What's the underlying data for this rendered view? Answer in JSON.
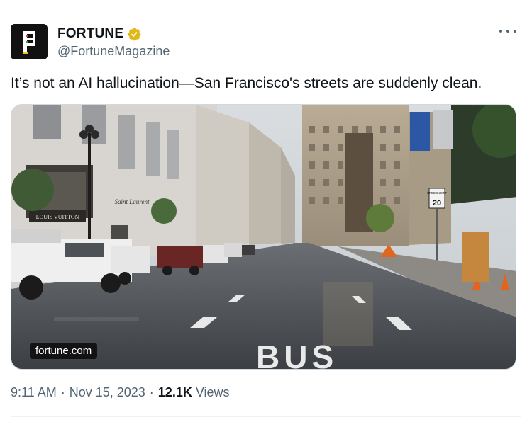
{
  "author": {
    "name": "FORTUNE",
    "handle": "@FortuneMagazine",
    "avatar_letter": "F",
    "verified": true,
    "avatar_icon": "fortune-logo-icon",
    "verified_icon": "verified-badge-icon"
  },
  "tweet": {
    "text": "It’s not an AI hallucination—San Francisco's streets are suddenly clean."
  },
  "media": {
    "source_label": "fortune.com",
    "storefront_sign": "LOUIS VUITTON",
    "store_script": "Saint Laurent",
    "speed_sign_top": "SPEED LIMIT",
    "speed_sign_value": "20",
    "road_marking": "BUS"
  },
  "meta": {
    "time": "9:11 AM",
    "date": "Nov 15, 2023",
    "views_count": "12.1K",
    "views_label": "Views",
    "separator": "·"
  },
  "menu": {
    "more_icon": "more-options-icon"
  },
  "colors": {
    "verified_gold": "#e2b719",
    "text_primary": "#0f1419",
    "text_secondary": "#536471"
  }
}
